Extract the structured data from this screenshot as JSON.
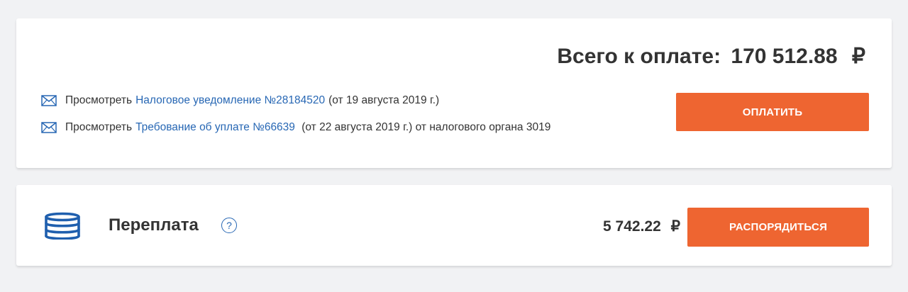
{
  "payment": {
    "total_label": "Всего к оплате:",
    "total_amount": "170 512.88",
    "currency": "₽",
    "pay_button": "Оплатить",
    "documents": [
      {
        "prefix": "Просмотреть",
        "link": "Налоговое уведомление №28184520",
        "suffix": "(от 19 августа 2019 г.)"
      },
      {
        "prefix": "Просмотреть",
        "link": "Требование об уплате №66639",
        "suffix": " (от 22 августа 2019 г.) от налогового органа 3019"
      }
    ]
  },
  "overpayment": {
    "title": "Переплата",
    "help_icon": "?",
    "amount": "5 742.22",
    "currency": "₽",
    "manage_button": "Распорядиться"
  },
  "colors": {
    "accent": "#ee6531",
    "link": "#2767b4",
    "background": "#f1f2f4"
  },
  "icons": [
    "envelope-icon",
    "coins-stack-icon",
    "question-icon"
  ]
}
